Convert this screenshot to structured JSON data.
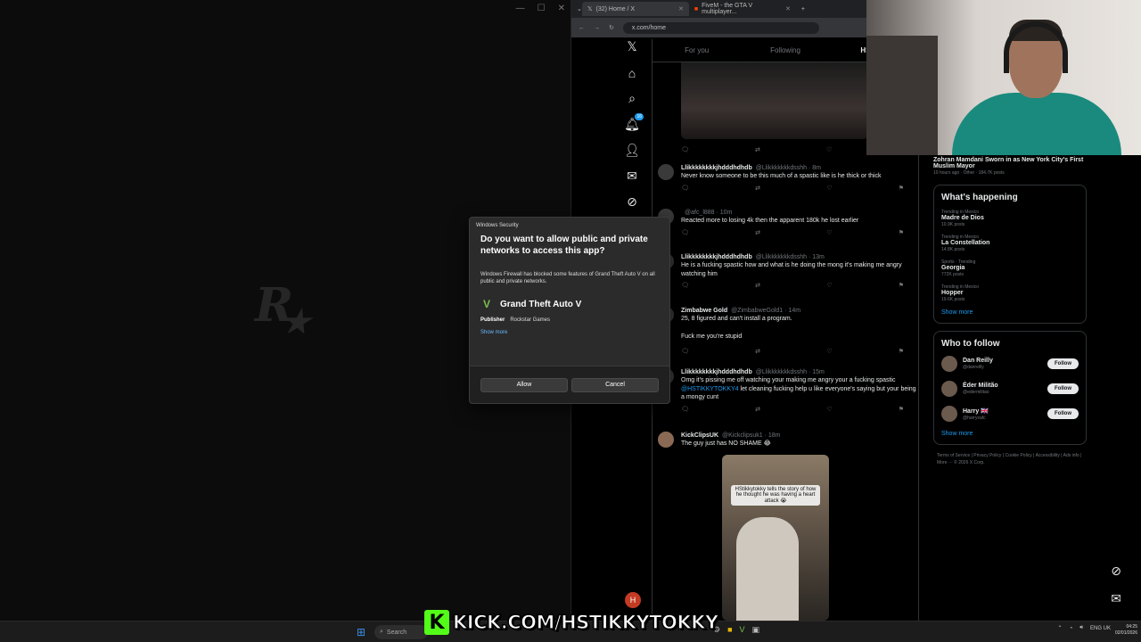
{
  "left_window": {
    "controls": [
      "—",
      "☐",
      "✕"
    ]
  },
  "browser": {
    "tabs": [
      {
        "label": "(32) Home / X"
      },
      {
        "label": "FiveM - the GTA V multiplayer..."
      }
    ],
    "url": "x.com/home"
  },
  "x_nav": {
    "notifications_badge": "16",
    "profile_initial": "H"
  },
  "feed": {
    "tabs": [
      "For you",
      "Following",
      "HS LOV"
    ],
    "tweets": [
      {
        "name": "Llikkkkkkkkjhdddhdhdb",
        "handle": "@Llikkkkkkkdsshh · 8m",
        "text": "Never know someone to be this much of a spastic like is he thick or thick"
      },
      {
        "name": "",
        "handle": "@afc_l888 · 10m",
        "text": "Reacted more to losing 4k then the apparent 180k he lost earlier"
      },
      {
        "name": "Llikkkkkkkkjhdddhdhdb",
        "handle": "@Llikkkkkkkdsshh · 13m",
        "text": "He is a fucking spastic how and what is he doing the mong it's making me angry watching him"
      },
      {
        "name": "Zimbabwe Gold",
        "handle": "@ZimbabweGold1 · 14m",
        "text": "25, 8 figured and can't install a program.",
        "text2": "Fuck me you're stupid"
      },
      {
        "name": "Llikkkkkkkkjhdddhdhdb",
        "handle": "@Llikkkkkkkdsshh · 15m",
        "text": "Omg it's pissing me off watching your making me angry your a fucking spastic",
        "mention": "@HSTIKKYTOKKY4",
        "text_after": " let cleaning fucking help u like everyone's saying but your being a mongy cunt"
      },
      {
        "name": "KickClipsUK",
        "handle": "@Kickclipsuk1 · 18m",
        "text": "The guy just has NO SHAME 😂"
      }
    ],
    "video_caption": "HStikkytokky tells the story of how he thought he was having a heart attack 😭"
  },
  "right_panel": {
    "news_title": "Zohran Mamdani Sworn in as New York City's First Muslim Mayor",
    "news_meta": "10 hours ago · Other · 184.7K posts",
    "whats_happening": "What's happening",
    "trends": [
      {
        "meta": "Trending in Mexico",
        "name": "Madre de Dios",
        "posts": "10.9K posts"
      },
      {
        "meta": "Trending in Mexico",
        "name": "La Constellation",
        "posts": "14.8K posts"
      },
      {
        "meta": "Sports · Trending",
        "name": "Georgia",
        "posts": "772K posts"
      },
      {
        "meta": "Trending in Mexico",
        "name": "Hopper",
        "posts": "19.6K posts"
      }
    ],
    "show_more": "Show more",
    "who_to_follow": "Who to follow",
    "follow_suggestions": [
      {
        "name": "Dan Reilly",
        "handle": "@danreilly",
        "button": "Follow"
      },
      {
        "name": "Éder Militão",
        "handle": "@edermilitao",
        "button": "Follow"
      },
      {
        "name": "Harry 🇬🇧",
        "handle": "@harryxafc",
        "button": "Follow"
      }
    ],
    "show_more_follow": "Show more",
    "footer": "Terms of Service | Privacy Policy | Cookie Policy | Accessibility | Ads info | More ··· © 2026 X Corp."
  },
  "dialog": {
    "app_title": "Windows Security",
    "question": "Do you want to allow public and private networks to access this app?",
    "message": "Windows Firewall has blocked some features of Grand Theft Auto V on all public and private networks.",
    "app_name": "Grand Theft Auto V",
    "publisher_label": "Publisher",
    "publisher": "Rockstar Games",
    "show_more": "Show more",
    "allow": "Allow",
    "cancel": "Cancel"
  },
  "taskbar": {
    "search": "Search",
    "language": "ENG UK",
    "time": "04:25",
    "date": "02/01/2026"
  },
  "overlay": {
    "kick_letter": "K",
    "kick_url": "KICK.COM/HSTIKKYTOKKY"
  },
  "colors": {
    "accent": "#1d9bf0",
    "kick_green": "#53fc18",
    "dialog_bg": "#2b2b2b"
  }
}
